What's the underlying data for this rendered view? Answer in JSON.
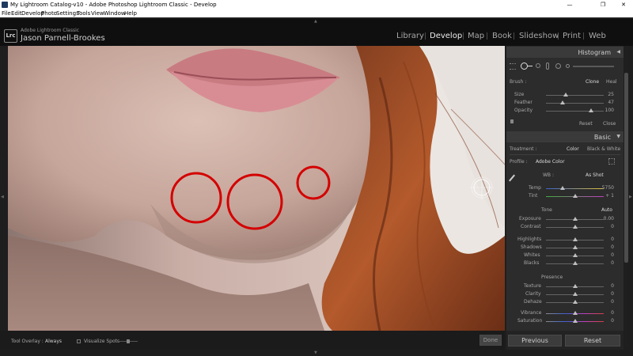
{
  "window": {
    "title": "My Lightroom Catalog-v10 - Adobe Photoshop Lightroom Classic - Develop",
    "minimize": "—",
    "maximize": "❐",
    "close": "✕"
  },
  "menubar": {
    "items": [
      "File",
      "Edit",
      "Develop",
      "Photo",
      "Settings",
      "Tools",
      "View",
      "Window",
      "Help"
    ]
  },
  "identity": {
    "badge": "Lrc",
    "app_name": "Adobe Lightroom Classic",
    "user_name": "Jason Parnell-Brookes"
  },
  "modules": {
    "items": [
      "Library",
      "Develop",
      "Map",
      "Book",
      "Slideshow",
      "Print",
      "Web"
    ],
    "active": "Develop"
  },
  "toolbar": {
    "tool_overlay_label": "Tool Overlay :",
    "tool_overlay_value": "Always",
    "visualize_spots_label": "Visualize Spots",
    "done_label": "Done"
  },
  "histogram": {
    "title": "Histogram"
  },
  "spot_removal": {
    "brush_label": "Brush :",
    "clone_label": "Clone",
    "heal_label": "Heal",
    "size_label": "Size",
    "size_value": "25",
    "feather_label": "Feather",
    "feather_value": "47",
    "opacity_label": "Opacity",
    "opacity_value": "100",
    "reset_label": "Reset",
    "close_label": "Close"
  },
  "basic": {
    "title": "Basic",
    "treatment_label": "Treatment :",
    "treatment_color": "Color",
    "treatment_bw": "Black & White",
    "profile_label": "Profile :",
    "profile_value": "Adobe Color",
    "wb_label": "WB :",
    "wb_value": "As Shot",
    "temp_label": "Temp",
    "temp_value": "5750",
    "tint_label": "Tint",
    "tint_value": "+ 1",
    "tone_label": "Tone",
    "auto_label": "Auto",
    "exposure_label": "Exposure",
    "exposure_value": "0.00",
    "contrast_label": "Contrast",
    "contrast_value": "0",
    "highlights_label": "Highlights",
    "highlights_value": "0",
    "shadows_label": "Shadows",
    "shadows_value": "0",
    "whites_label": "Whites",
    "whites_value": "0",
    "blacks_label": "Blacks",
    "blacks_value": "0",
    "presence_label": "Presence",
    "texture_label": "Texture",
    "texture_value": "0",
    "clarity_label": "Clarity",
    "clarity_value": "0",
    "dehaze_label": "Dehaze",
    "dehaze_value": "0",
    "vibrance_label": "Vibrance",
    "vibrance_value": "0",
    "saturation_label": "Saturation",
    "saturation_value": "0"
  },
  "footer": {
    "previous_label": "Previous",
    "reset_label": "Reset"
  },
  "colors": {
    "annotation_red": "#d40000",
    "panel_bg": "#2c2c2c",
    "header_bg": "#3a3a3a"
  }
}
